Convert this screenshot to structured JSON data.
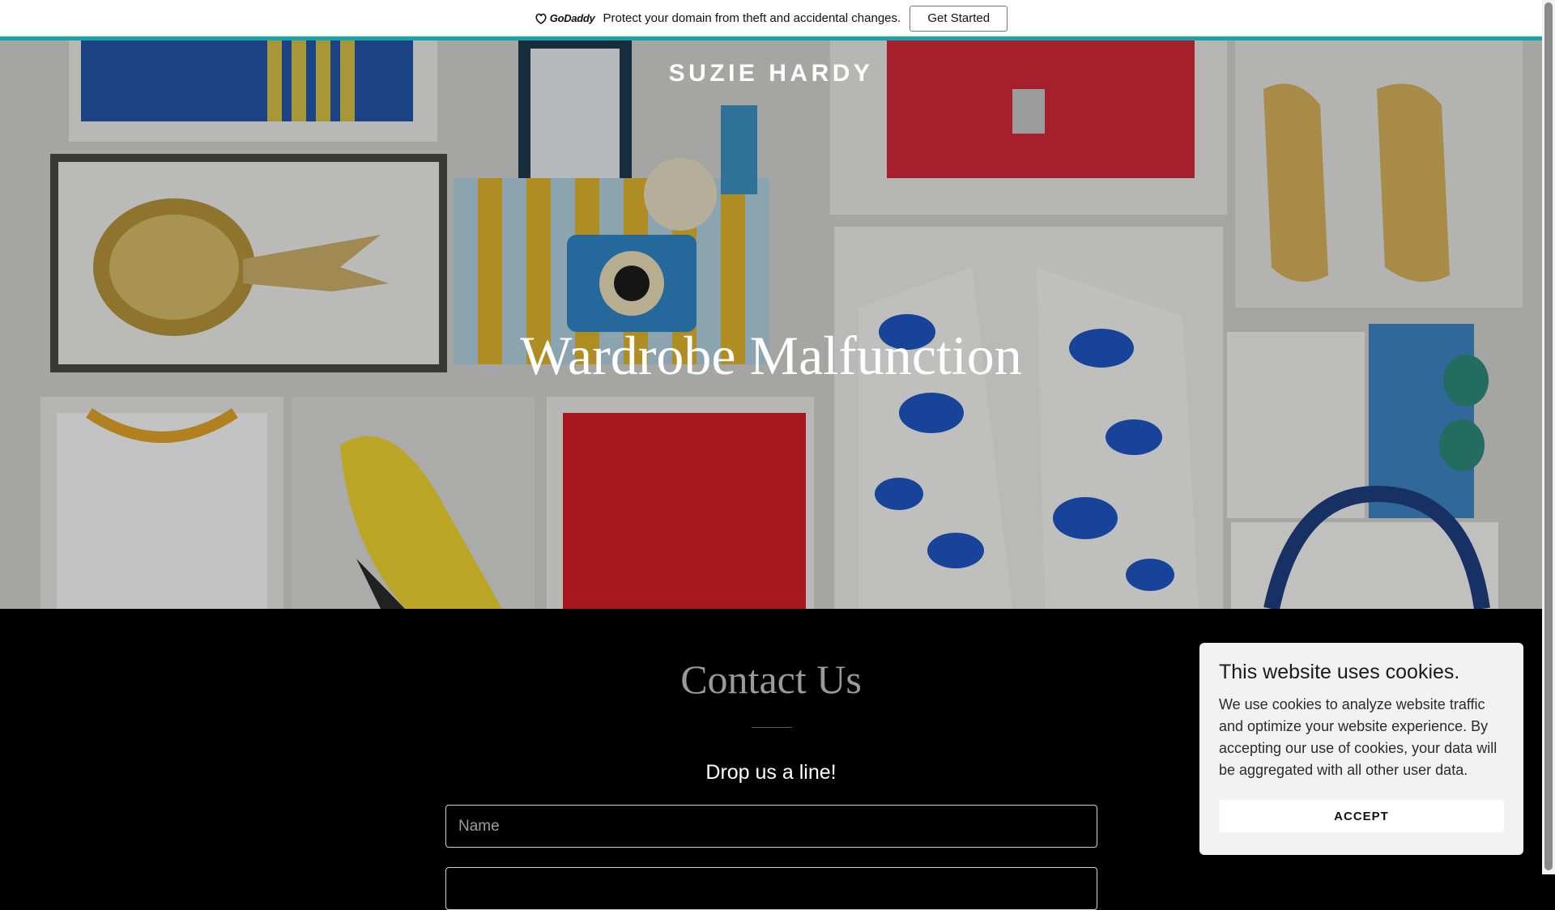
{
  "promo": {
    "logo_text": "GoDaddy",
    "message": "Protect your domain from theft and accidental changes.",
    "button_label": "Get Started",
    "accent_color": "#19a5a5"
  },
  "hero": {
    "site_name": "SUZIE HARDY",
    "title": "Wardrobe Malfunction"
  },
  "contact": {
    "title": "Contact Us",
    "subtitle": "Drop us a line!",
    "name_placeholder": "Name"
  },
  "cookie_banner": {
    "title": "This website uses cookies.",
    "body": "We use cookies to analyze website traffic and optimize your website experience. By accepting our use of cookies, your data will be aggregated with all other user data.",
    "accept_label": "ACCEPT"
  }
}
